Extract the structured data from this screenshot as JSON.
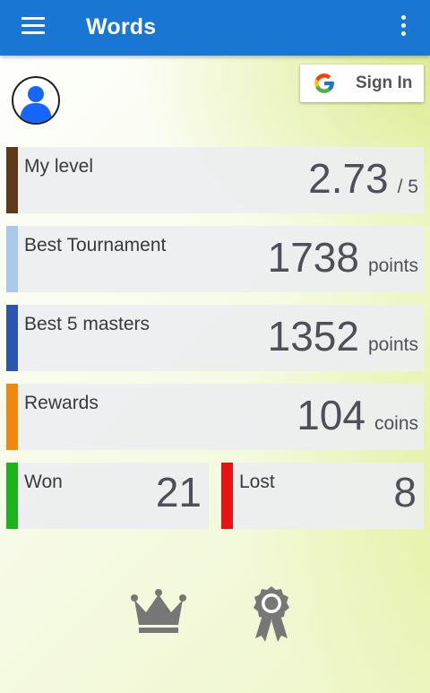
{
  "app": {
    "title": "Words"
  },
  "signin": {
    "label": "Sign In"
  },
  "stats": [
    {
      "label": "My level",
      "value": "2.73",
      "unit": "/ 5",
      "color": "#5d3a1a"
    },
    {
      "label": "Best Tournament",
      "value": "1738",
      "unit": "points",
      "color": "#a9c8ec"
    },
    {
      "label": "Best 5 masters",
      "value": "1352",
      "unit": "points",
      "color": "#2a55b0"
    },
    {
      "label": "Rewards",
      "value": "104",
      "unit": "coins",
      "color": "#f0880e"
    }
  ],
  "record": {
    "won": {
      "label": "Won",
      "value": "21",
      "color": "#1db31d"
    },
    "lost": {
      "label": "Lost",
      "value": "8",
      "color": "#e81212"
    }
  },
  "icons": {
    "menu": "hamburger-menu-icon",
    "more": "overflow-menu-icon",
    "avatar": "user-avatar-icon",
    "google": "google-g-icon",
    "crown": "crown-icon",
    "award": "award-ribbon-icon"
  },
  "colors": {
    "appbar": "#1976d2",
    "icon_gray": "#777777"
  }
}
